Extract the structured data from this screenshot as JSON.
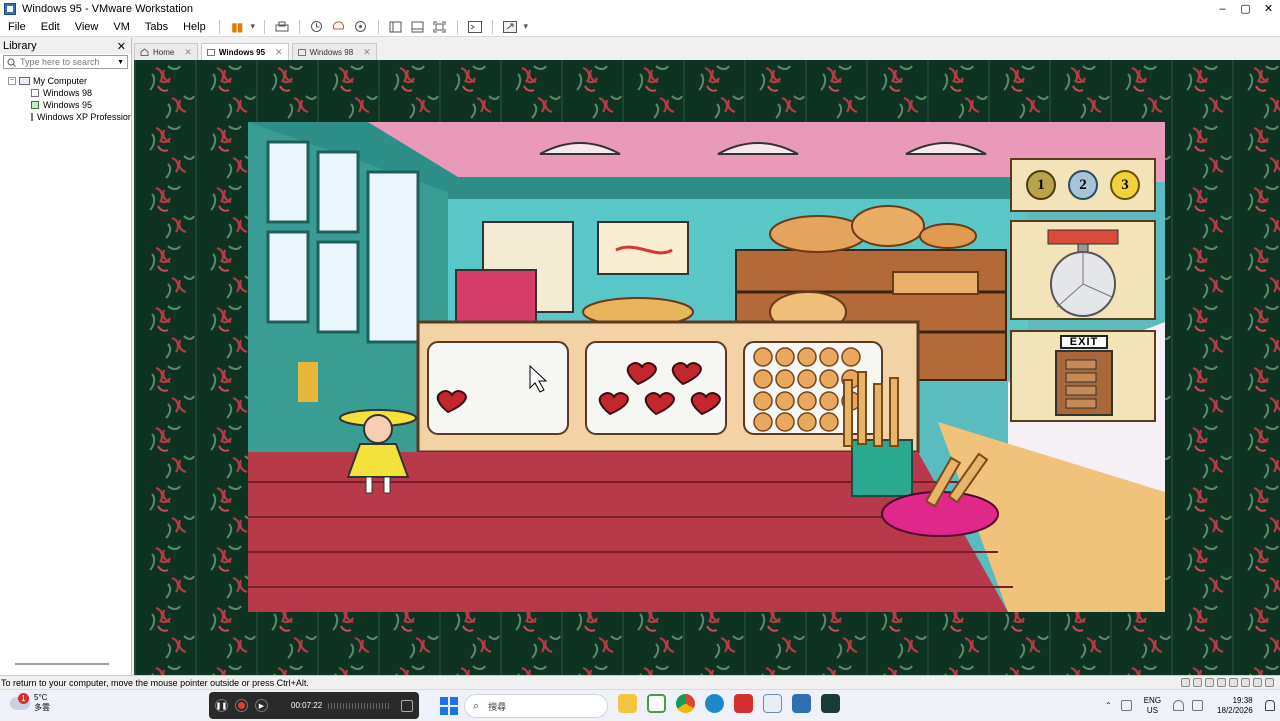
{
  "window": {
    "title": "Windows 95 - VMware Workstation",
    "minimize": "–",
    "maximize": "▢",
    "close": "✕"
  },
  "menu": {
    "items": [
      "File",
      "Edit",
      "View",
      "VM",
      "Tabs",
      "Help"
    ]
  },
  "toolbar": {
    "pause_glyph": "▮▮",
    "dropdown_glyph": "▾",
    "icons": [
      "send-keys-icon",
      "snapshot-icon",
      "revert-snapshot-icon",
      "snapshot-manager-icon",
      "console-view-icon",
      "quick-switch-icon",
      "full-screen-icon",
      "terminal-icon",
      "stretch-guest-icon"
    ]
  },
  "sidebar": {
    "title": "Library",
    "close": "✕",
    "search_placeholder": "Type here to search",
    "root": {
      "expander": "−",
      "label": "My Computer"
    },
    "items": [
      {
        "label": "Windows 98"
      },
      {
        "label": "Windows 95"
      },
      {
        "label": "Windows XP Professional"
      }
    ]
  },
  "tabs": [
    {
      "label": "Home",
      "close": "✕"
    },
    {
      "label": "Windows 95",
      "close": "✕",
      "active": true
    },
    {
      "label": "Windows 98",
      "close": "✕"
    }
  ],
  "game": {
    "medals": [
      "1",
      "2",
      "3"
    ],
    "exit_label": "EXIT"
  },
  "status": {
    "message": "To return to your computer, move the mouse pointer outside or press Ctrl+Alt."
  },
  "taskbar": {
    "weather": {
      "badge": "1",
      "temp": "5°C",
      "desc": "多雲"
    },
    "recorder": {
      "time": "00:07:22"
    },
    "search_label": "搜尋",
    "tray": {
      "lang1": "ENG",
      "lang2": "US",
      "time": "19:38",
      "date": "18/2/2026"
    }
  },
  "colors": {
    "vm_background": "#0e3322",
    "accent_pause": "#e07a00",
    "recorder_dot": "#e53935"
  }
}
